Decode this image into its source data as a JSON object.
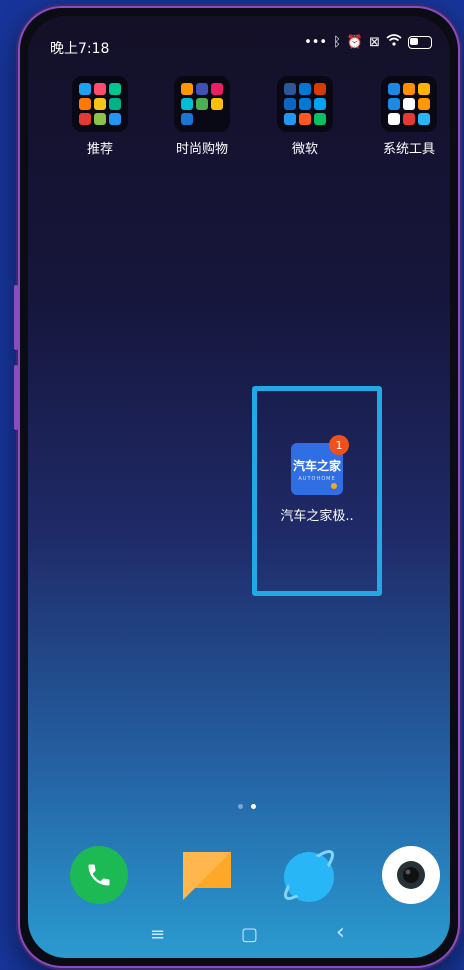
{
  "status_bar": {
    "time": "晚上7:18",
    "icons": [
      "dots-icon",
      "bluetooth-icon",
      "alarm-off-icon",
      "sim-icon",
      "wifi-icon",
      "battery-icon"
    ]
  },
  "folders": [
    {
      "label": "推荐",
      "colors": [
        "#1da1f2",
        "#ff4d6d",
        "#00c58e",
        "#ff7a00",
        "#f5c518",
        "#00b386",
        "#e53935",
        "#8bc34a",
        "#2196f3"
      ]
    },
    {
      "label": "时尚购物",
      "colors": [
        "#ff9800",
        "#3f51b5",
        "#e91e63",
        "#00bcd4",
        "#4caf50",
        "#ffc107",
        "#1976d2"
      ]
    },
    {
      "label": "微软",
      "colors": [
        "#2b579a",
        "#0078d4",
        "#d83b01",
        "#0a66c2",
        "#0078d4",
        "#00a4ef",
        "#2196f3",
        "#ff5722",
        "#07c160"
      ]
    },
    {
      "label": "系统工具",
      "colors": [
        "#1e88e5",
        "#ff8f00",
        "#ffb300",
        "#1e88e5",
        "#ffffff",
        "#ff9800",
        "#ffffff",
        "#e53935",
        "#29b6f6"
      ]
    }
  ],
  "app": {
    "label": "汽车之家极..",
    "icon_text": "汽车之家",
    "icon_subtext": "AUTOHOME",
    "badge_count": "1",
    "icon_color": "#2f6fe3"
  },
  "highlight_color": "#23a8e6",
  "page_indicator": {
    "total": 2,
    "active_index": 1
  },
  "dock": [
    {
      "name": "phone-icon",
      "color": "#1db954"
    },
    {
      "name": "message-icon",
      "color": "#ffb74d"
    },
    {
      "name": "browser-icon",
      "color": "#29b6f6"
    },
    {
      "name": "camera-icon",
      "color": "#ffffff"
    }
  ],
  "nav_bar": {
    "menu_glyph": "≡",
    "home_glyph": "▢",
    "back_glyph": "‹"
  }
}
